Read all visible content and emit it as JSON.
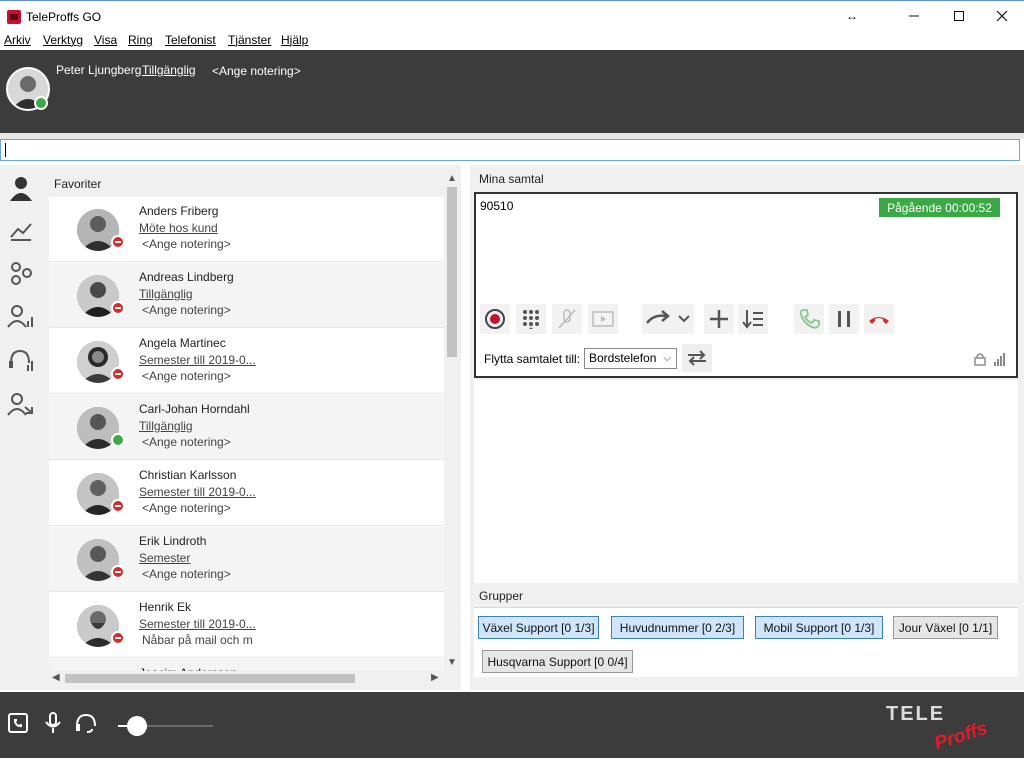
{
  "window": {
    "title": "TeleProffs GO",
    "resize_glyph": "↔"
  },
  "menu": [
    {
      "label": "Arkiv"
    },
    {
      "label": "Verktyg"
    },
    {
      "label": "Visa"
    },
    {
      "label": "Ring"
    },
    {
      "label": "Telefonist"
    },
    {
      "label": "Tjänster"
    },
    {
      "label": "Hjälp"
    }
  ],
  "user": {
    "name": "Peter Ljungberg",
    "status": "Tillgänglig",
    "note": "<Ange notering>",
    "presence": "available"
  },
  "search": {
    "value": "",
    "placeholder": ""
  },
  "rail": [
    {
      "icon": "person-icon"
    },
    {
      "icon": "handshake-icon"
    },
    {
      "icon": "network-icon"
    },
    {
      "icon": "group-signal-icon"
    },
    {
      "icon": "headset-signal-icon"
    },
    {
      "icon": "group-transfer-icon"
    }
  ],
  "favorites": {
    "header": "Favoriter",
    "contacts": [
      {
        "name": "Anders Friberg",
        "status": "Möte hos kund",
        "note": "<Ange notering>",
        "presence": "busy"
      },
      {
        "name": "Andreas Lindberg",
        "status": "Tillgänglig",
        "note": "<Ange notering>",
        "presence": "on-call"
      },
      {
        "name": "Angela Martinec",
        "status": "Semester till 2019-0...",
        "note": "<Ange notering>",
        "presence": "busy"
      },
      {
        "name": "Carl-Johan Horndahl",
        "status": "Tillgänglig",
        "note": "<Ange notering>",
        "presence": "available"
      },
      {
        "name": "Christian Karlsson",
        "status": "Semester till 2019-0...",
        "note": "<Ange notering>",
        "presence": "busy"
      },
      {
        "name": "Erik Lindroth",
        "status": "Semester",
        "note": "<Ange notering>",
        "presence": "busy"
      },
      {
        "name": "Henrik Ek",
        "status": "Semester till 2019-0...",
        "note": "Nåbar på mail och m",
        "presence": "busy"
      },
      {
        "name": "Joacim Andersson",
        "status": "",
        "note": "",
        "presence": "busy"
      }
    ]
  },
  "calls": {
    "header": "Mina samtal",
    "active": {
      "number": "90510",
      "badge": "Pågående 00:00:52"
    },
    "move_label": "Flytta samtalet till:",
    "move_target": "Bordstelefon"
  },
  "groups": {
    "header": "Grupper",
    "items": [
      {
        "label": "Växel Support [0 1/3]",
        "active": true
      },
      {
        "label": "Huvudnummer [0 2/3]",
        "active": true
      },
      {
        "label": "Mobil Support [0 1/3]",
        "active": true
      },
      {
        "label": "Jour Växel [0 1/1]",
        "active": false
      },
      {
        "label": "Husqvarna Support [0 0/4]",
        "active": false
      }
    ]
  },
  "volume": {
    "level": 0.2
  },
  "brand": {
    "line1": "TELE",
    "line2": "Proffs"
  },
  "colors": {
    "header_bg": "#3c3c3c",
    "available": "#3aaa45",
    "busy": "#d62b2b",
    "accent": "#3a7fc0",
    "call_badge": "#3aaa45"
  }
}
